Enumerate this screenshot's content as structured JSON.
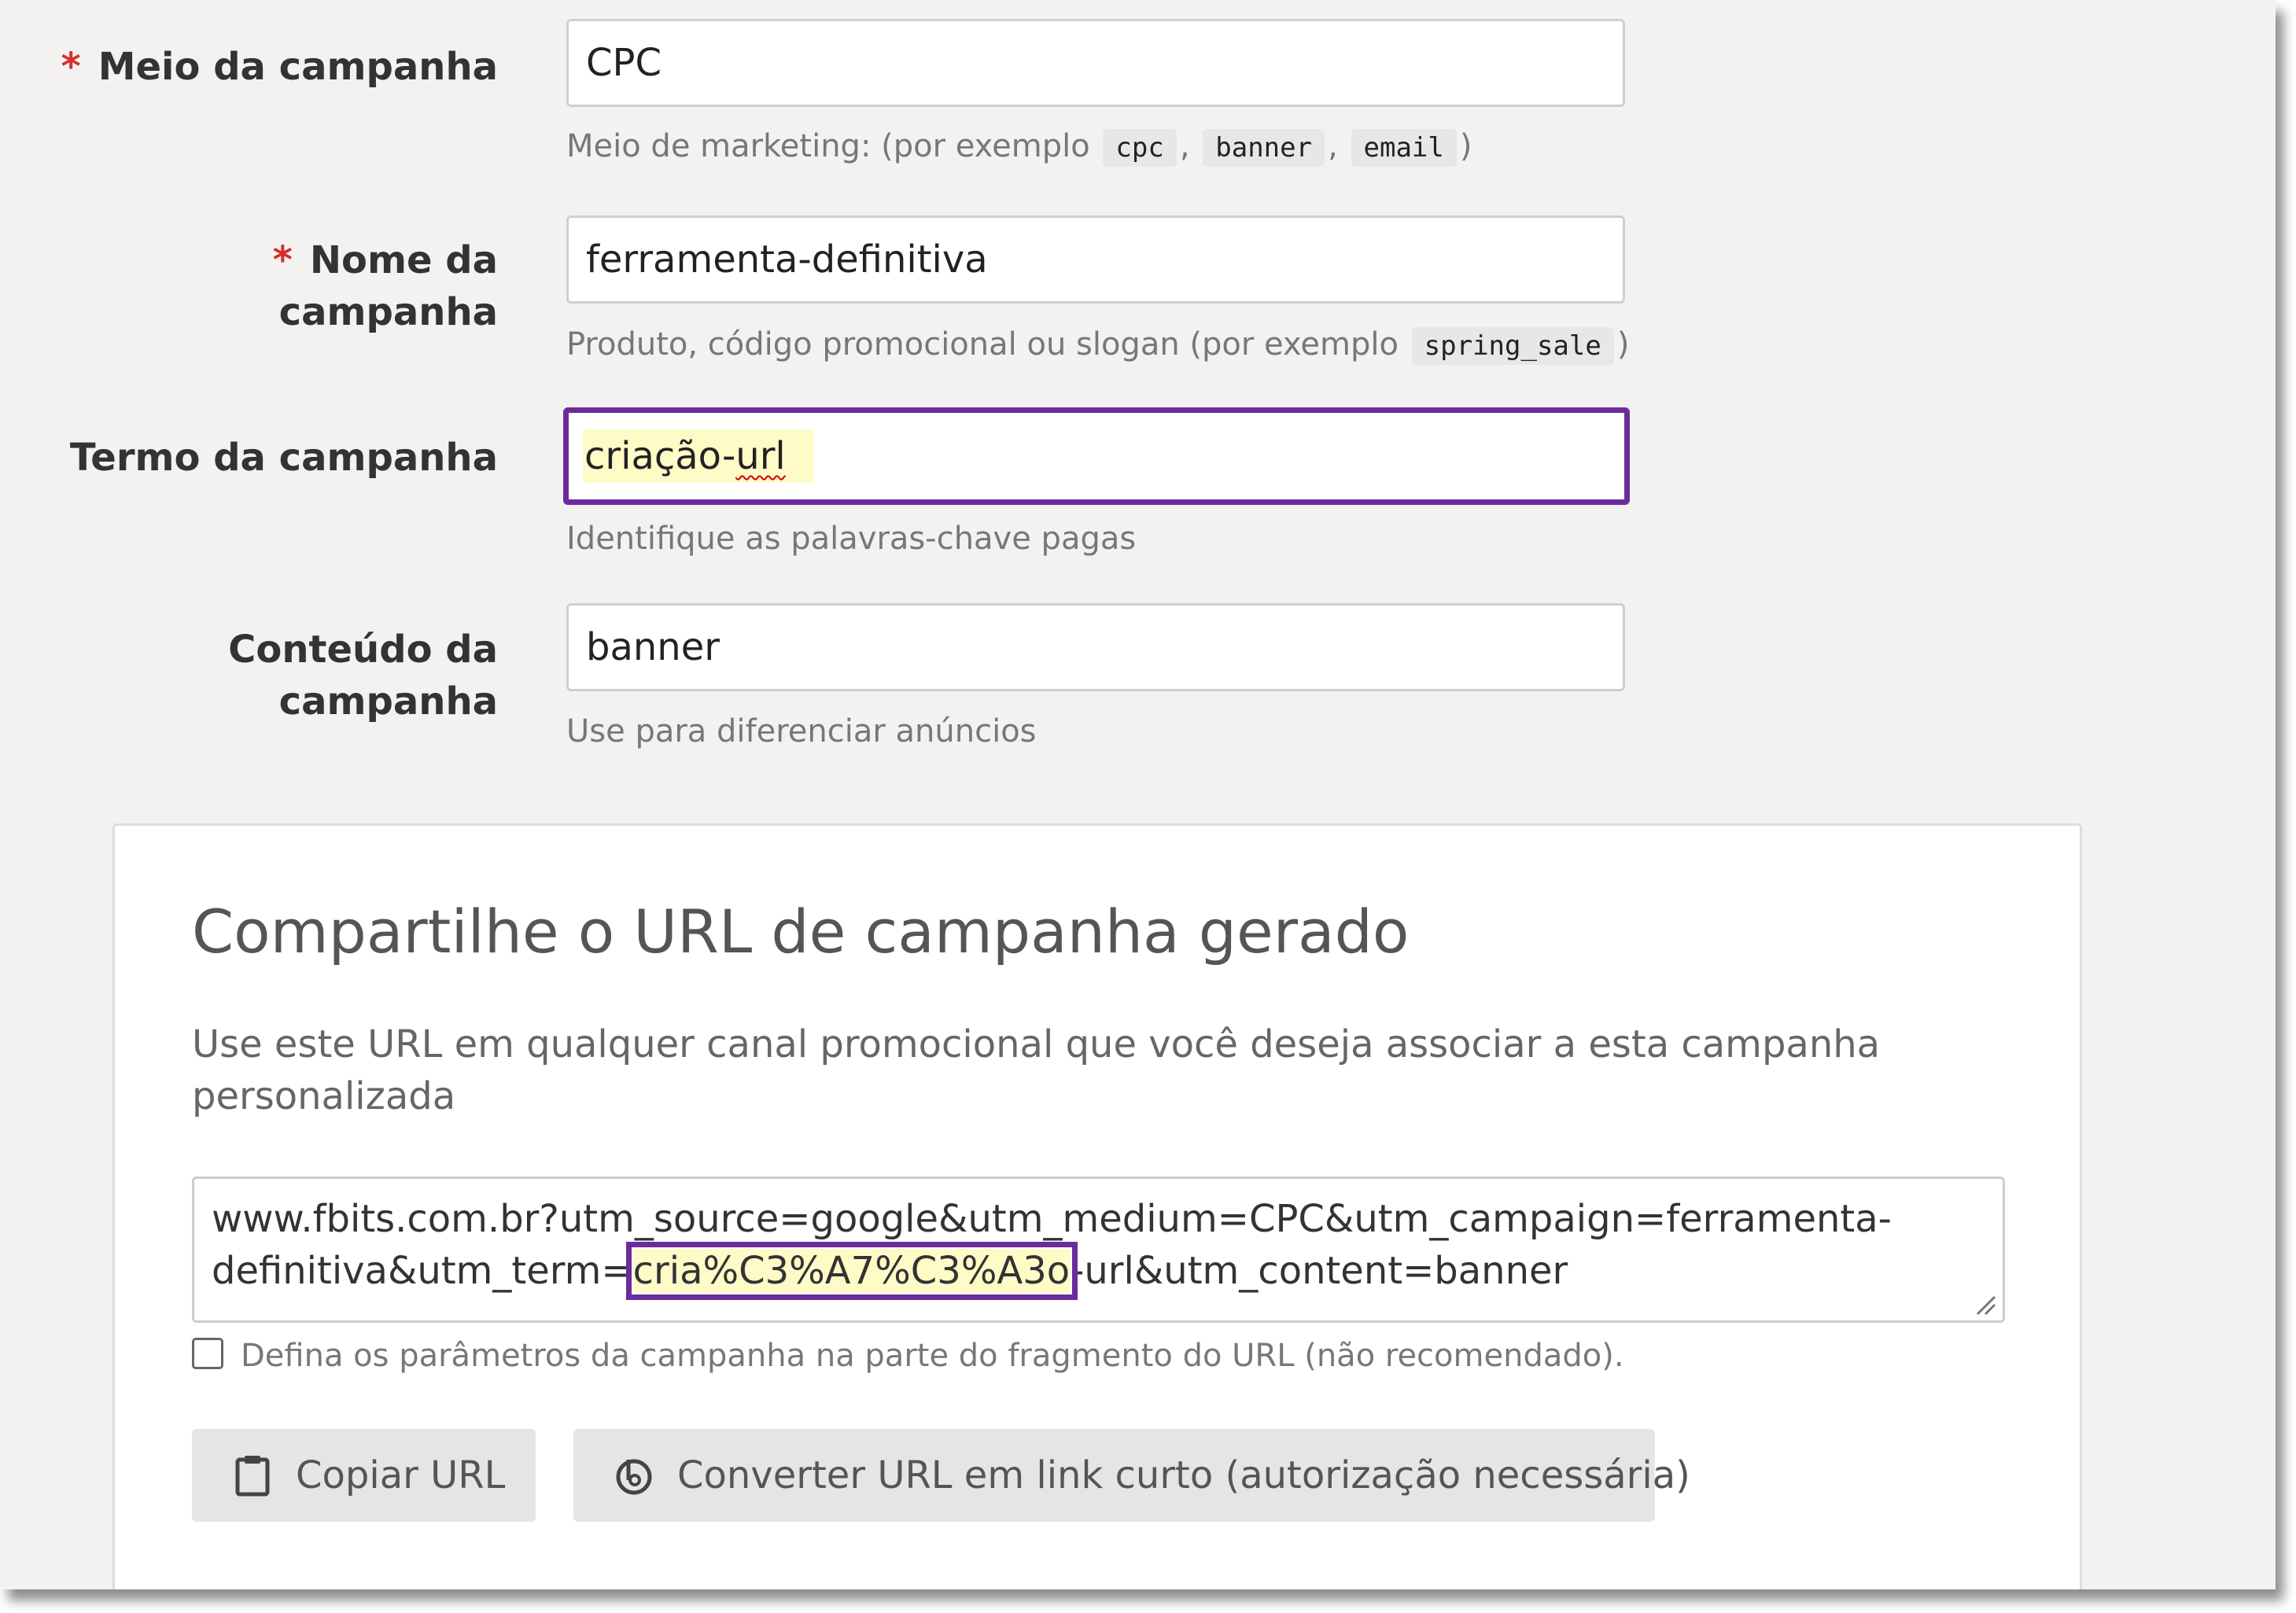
{
  "form": {
    "medium": {
      "label": "Meio da campanha",
      "required_mark": "*",
      "value": "CPC",
      "help_prefix": "Meio de marketing: (por exemplo",
      "examples": [
        "cpc",
        "banner",
        "email"
      ],
      "help_suffix": ")"
    },
    "name": {
      "label_line1": "Nome da",
      "label_line2": "campanha",
      "required_mark": "*",
      "value": "ferramenta-definitiva",
      "help_prefix": "Produto, código promocional ou slogan (por exemplo",
      "example": "spring_sale",
      "help_suffix": ")"
    },
    "term": {
      "label": "Termo da campanha",
      "value_part1": "criação-",
      "value_part2": "url",
      "help": "Identifique as palavras-chave pagas"
    },
    "content": {
      "label_line1": "Conteúdo da",
      "label_line2": "campanha",
      "value": "banner",
      "help": "Use para diferenciar anúncios"
    }
  },
  "share": {
    "title": "Compartilhe o URL de campanha gerado",
    "description": "Use este URL em qualquer canal promocional que você deseja associar a esta campanha personalizada",
    "url_line1": "www.fbits.com.br?utm_source=google&utm_medium=CPC&utm_campaign=ferramenta-",
    "url_line2_before": "definitiva&utm_term=",
    "url_line2_highlight": "cria%C3%A7%C3%A3o",
    "url_line2_after": "-url&utm_content=banner",
    "fragment_checkbox_label": "Defina os parâmetros da campanha na parte do fragmento do URL (não recomendado).",
    "fragment_checked": false,
    "copy_button": "Copiar URL",
    "shorten_button": "Converter URL em link curto (autorização necessária)"
  },
  "colors": {
    "highlight_border": "#6a2c9c",
    "highlight_fill": "#fffbc7",
    "required": "#d32f2f",
    "background": "#f4f2f1"
  },
  "icons": [
    "clipboard-icon",
    "bitly-icon",
    "resize-handle-icon"
  ]
}
